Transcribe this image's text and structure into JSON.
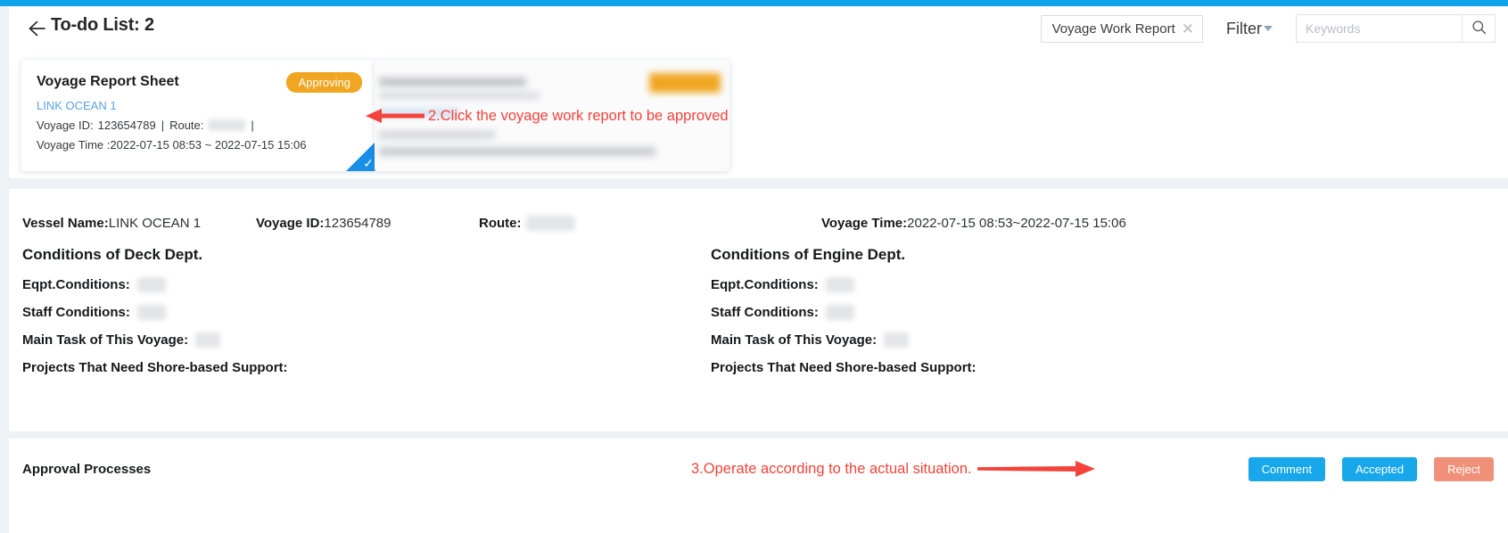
{
  "header": {
    "title": "To-do List: 2",
    "back_icon": "arrow-left-icon",
    "chip_label": "Voyage Work Report",
    "chip_close_icon": "close-icon",
    "filter_label": "Filter",
    "search_placeholder": "Keywords",
    "search_value": "",
    "search_icon": "search-icon"
  },
  "cards": [
    {
      "title": "Voyage Report Sheet",
      "badge": "Approving",
      "vessel": "LINK OCEAN 1",
      "voyage_id_label": "Voyage ID:",
      "voyage_id": "123654789",
      "separator": "|",
      "route_label": "Route:",
      "route_value": "",
      "time_label": "Voyage Time :",
      "time_value": "2022-07-15 08:53 ~ 2022-07-15 15:06",
      "selected": true,
      "check_icon": "check-icon"
    },
    {
      "title": "",
      "badge": "",
      "vessel": "",
      "blurred": true
    }
  ],
  "annotations": [
    {
      "id": "anno-2",
      "text": "2.Click the voyage work report to be approved",
      "color": "#f4433a",
      "arrow_icon": "arrow-left-icon"
    },
    {
      "id": "anno-3",
      "text": "3.Operate according to the actual situation.",
      "color": "#f4433a",
      "arrow_icon": "arrow-right-icon"
    }
  ],
  "detail": {
    "meta": {
      "vessel_name_label": "Vessel Name:",
      "vessel_name_value": "LINK OCEAN 1",
      "voyage_id_label": "Voyage ID:",
      "voyage_id_value": "123654789",
      "route_label": "Route:",
      "route_value": "",
      "voyage_time_label": "Voyage Time:",
      "voyage_time_value": "2022-07-15 08:53~2022-07-15 15:06"
    },
    "deck": {
      "heading": "Conditions of Deck Dept.",
      "eqpt_label": "Eqpt.Conditions:",
      "eqpt_value": "",
      "staff_label": "Staff Conditions:",
      "staff_value": "",
      "main_task_label": "Main Task of This Voyage:",
      "main_task_value": "",
      "shore_label": "Projects That Need Shore-based Support:",
      "shore_value": ""
    },
    "engine": {
      "heading": "Conditions of Engine Dept.",
      "eqpt_label": "Eqpt.Conditions:",
      "eqpt_value": "",
      "staff_label": "Staff Conditions:",
      "staff_value": "",
      "main_task_label": "Main Task of This Voyage:",
      "main_task_value": "",
      "shore_label": "Projects That Need Shore-based Support:",
      "shore_value": ""
    }
  },
  "approval": {
    "title": "Approval Processes",
    "buttons": [
      {
        "label": "Comment",
        "style": "blue"
      },
      {
        "label": "Accepted",
        "style": "blue"
      },
      {
        "label": "Reject",
        "style": "red"
      }
    ]
  },
  "colors": {
    "top_bar": "#0fa4ea",
    "accent_blue": "#17a7ea",
    "badge_orange": "#f0a621",
    "reject_red": "#f09078",
    "annotation_red": "#f4433a",
    "link_blue": "#5ba3e0",
    "page_bg": "#eef1f5"
  }
}
